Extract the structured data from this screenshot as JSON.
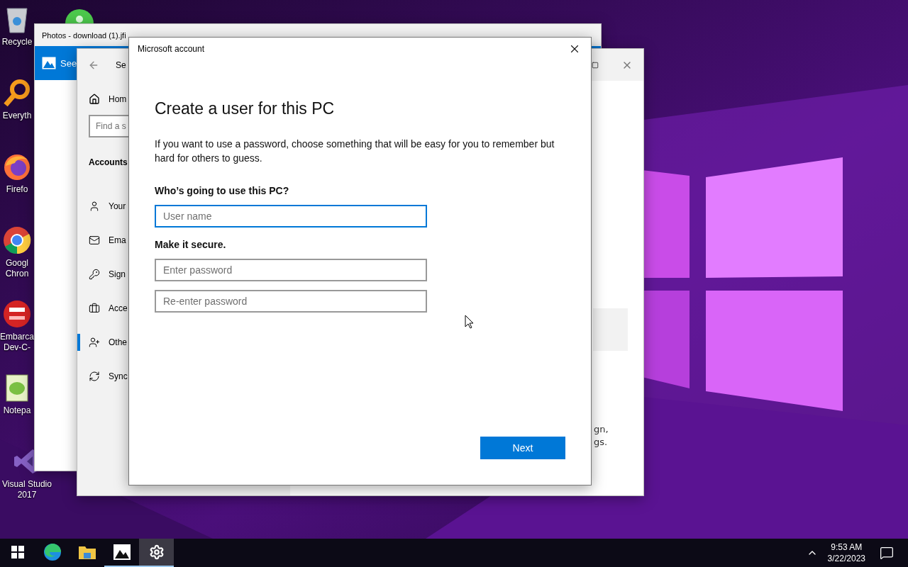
{
  "desktop_icons": [
    {
      "kind": "recycle",
      "label": "Recycle"
    },
    {
      "kind": "search",
      "label": "Everyth"
    },
    {
      "kind": "firefox",
      "label": "Firefo"
    },
    {
      "kind": "chrome",
      "label": "Googl Chron"
    },
    {
      "kind": "devcpp",
      "label": "Embarca Dev-C-"
    },
    {
      "kind": "notepad",
      "label": "Notepa"
    },
    {
      "kind": "vs",
      "label": "Visual Studio 2017"
    }
  ],
  "photos_window": {
    "title": "Photos - download (1).jfi",
    "tab": "See"
  },
  "settings_window": {
    "title": "Se",
    "home": "Hom",
    "search": {
      "placeholder": "Find a s"
    },
    "section": "Accounts",
    "items": [
      {
        "kind": "person",
        "label": "Your",
        "selected": false
      },
      {
        "kind": "mail",
        "label": "Ema",
        "selected": false
      },
      {
        "kind": "key",
        "label": "Sign",
        "selected": false
      },
      {
        "kind": "briefcase",
        "label": "Acce",
        "selected": false
      },
      {
        "kind": "person-add",
        "label": "Othe",
        "selected": true
      },
      {
        "kind": "sync",
        "label": "Sync",
        "selected": false
      }
    ],
    "fragments": [
      "gn,",
      "gs."
    ]
  },
  "dialog": {
    "title": "Microsoft account",
    "heading": "Create a user for this PC",
    "text": "If you want to use a password, choose something that will be easy for you to remember but hard for others to guess.",
    "sections": [
      {
        "label": "Who’s going to use this PC?",
        "fields": [
          {
            "placeholder": "User name",
            "focused": true
          }
        ]
      },
      {
        "label": "Make it secure.",
        "fields": [
          {
            "placeholder": "Enter password",
            "focused": false
          },
          {
            "placeholder": "Re-enter password",
            "focused": false
          }
        ]
      }
    ],
    "button": "Next"
  },
  "taskbar": {
    "apps": [
      {
        "kind": "start",
        "running": false,
        "selected": false
      },
      {
        "kind": "edge",
        "running": false,
        "selected": false
      },
      {
        "kind": "explorer",
        "running": false,
        "selected": false
      },
      {
        "kind": "photos",
        "running": true,
        "selected": false
      },
      {
        "kind": "settings",
        "running": true,
        "selected": true
      }
    ],
    "time": "9:53 AM",
    "date": "3/22/2023"
  }
}
